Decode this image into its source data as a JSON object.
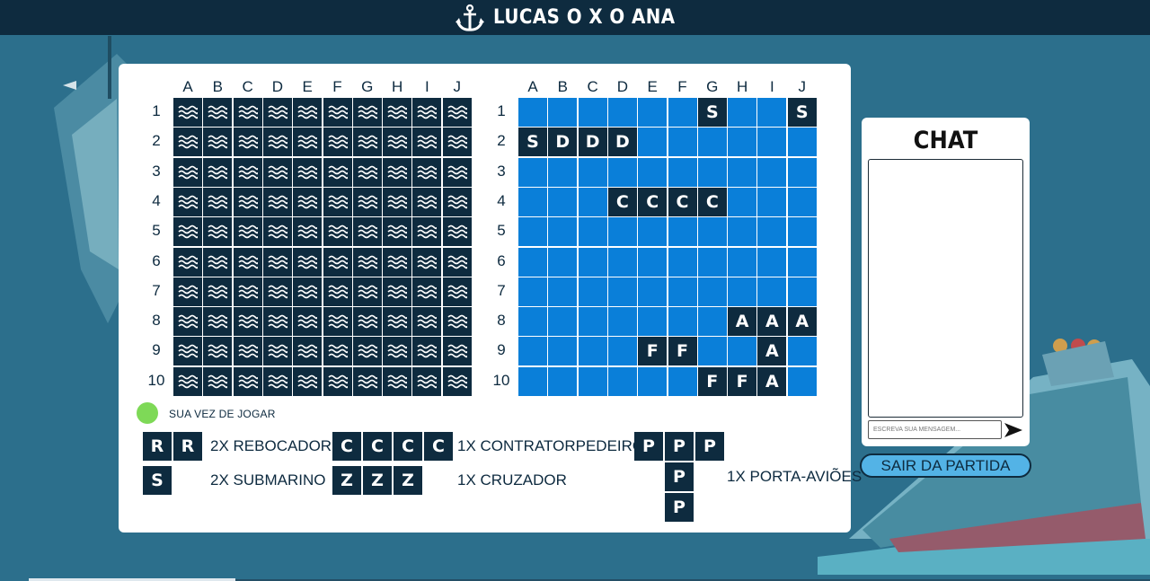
{
  "header": {
    "title": "LUCAS O X O ANA",
    "anchor_icon": "anchor-icon"
  },
  "colors": {
    "background": "#2c6f8c",
    "navy": "#0e2b3f",
    "water": "#0a7fd9",
    "turn_indicator": "#7ed957",
    "leave_button": "#53b3e6"
  },
  "board": {
    "columns": [
      "A",
      "B",
      "C",
      "D",
      "E",
      "F",
      "G",
      "H",
      "I",
      "J"
    ],
    "rows": [
      "1",
      "2",
      "3",
      "4",
      "5",
      "6",
      "7",
      "8",
      "9",
      "10"
    ]
  },
  "opponent_board": {
    "cell_icon": "wave-icon",
    "state": "hidden"
  },
  "own_board": {
    "grid": [
      [
        "",
        "",
        "",
        "",
        "",
        "",
        "S",
        "",
        "",
        "S"
      ],
      [
        "S",
        "D",
        "D",
        "D",
        "",
        "",
        "",
        "",
        "",
        ""
      ],
      [
        "",
        "",
        "",
        "",
        "",
        "",
        "",
        "",
        "",
        ""
      ],
      [
        "",
        "",
        "",
        "C",
        "C",
        "C",
        "C",
        "",
        "",
        ""
      ],
      [
        "",
        "",
        "",
        "",
        "",
        "",
        "",
        "",
        "",
        ""
      ],
      [
        "",
        "",
        "",
        "",
        "",
        "",
        "",
        "",
        "",
        ""
      ],
      [
        "",
        "",
        "",
        "",
        "",
        "",
        "",
        "",
        "",
        ""
      ],
      [
        "",
        "",
        "",
        "",
        "",
        "",
        "",
        "A",
        "A",
        "A"
      ],
      [
        "",
        "",
        "",
        "",
        "F",
        "F",
        "",
        "",
        "A",
        ""
      ],
      [
        "",
        "",
        "",
        "",
        "",
        "",
        "F",
        "F",
        "A",
        ""
      ]
    ]
  },
  "status": {
    "turn_text": "SUA VEZ DE JOGAR"
  },
  "legend": {
    "items": [
      {
        "letter": "R",
        "count": 2,
        "label": "2X REBOCADOR"
      },
      {
        "letter": "S",
        "count": 1,
        "label": "2X SUBMARINO"
      },
      {
        "letter": "C",
        "count": 4,
        "label": "1X CONTRATORPEDEIRO"
      },
      {
        "letter": "Z",
        "count": 3,
        "label": "1X CRUZADOR"
      },
      {
        "letter": "P",
        "count": 5,
        "label": "1X PORTA-AVIÕES"
      }
    ]
  },
  "chat": {
    "title": "CHAT",
    "input_placeholder": "ESCREVA SUA MENSAGEM...",
    "send_icon": "send-arrow-icon"
  },
  "actions": {
    "leave_label": "SAIR DA PARTIDA"
  }
}
